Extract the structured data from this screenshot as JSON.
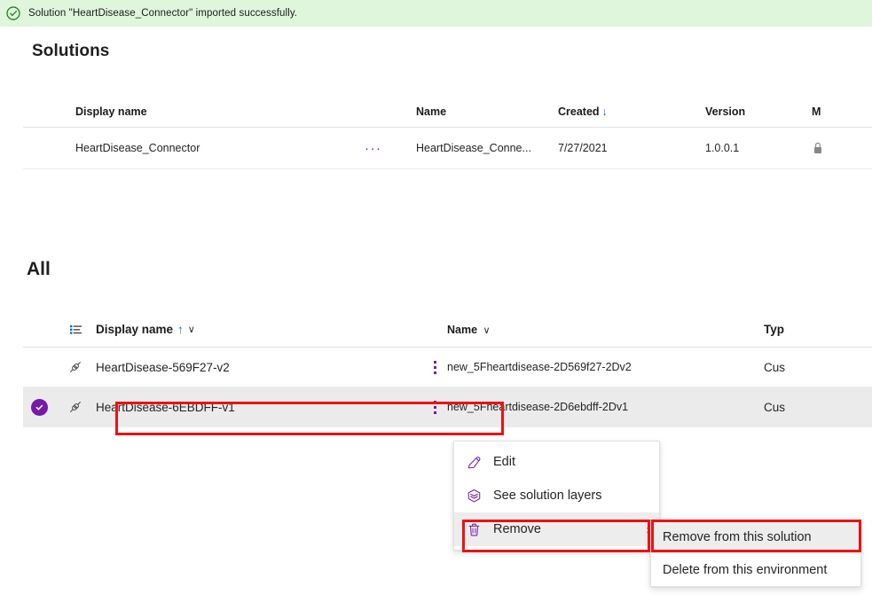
{
  "banner": {
    "icon": "check-circle-icon",
    "message": "Solution \"HeartDisease_Connector\" imported successfully."
  },
  "solutions_section": {
    "title": "Solutions",
    "columns": [
      {
        "label": "Display name"
      },
      {
        "label": "Name"
      },
      {
        "label": "Created",
        "sort": "↓"
      },
      {
        "label": "Version"
      },
      {
        "label": "M"
      }
    ],
    "rows": [
      {
        "display_name": "HeartDisease_Connector",
        "overflow_menu": "···",
        "name": "HeartDisease_Conne...",
        "created": "7/27/2021",
        "version": "1.0.0.1",
        "managed_icon": "managed-lock-icon"
      }
    ]
  },
  "all_section": {
    "title": "All",
    "columns": [
      {
        "label": "",
        "icon": "list-view-icon"
      },
      {
        "label": "Display name",
        "sort": "↑",
        "chevron": "∨"
      },
      {
        "label": "Name",
        "chevron": "∨"
      },
      {
        "label": "Typ"
      }
    ],
    "rows": [
      {
        "selected": false,
        "icon": "connector-icon",
        "display_name": "HeartDisease-569F27-v2",
        "kebab": "kebab-menu-icon",
        "name": "new_5Fheartdisease-2D569f27-2Dv2",
        "type": "Cus"
      },
      {
        "selected": true,
        "check_icon": "selected-check-icon",
        "icon": "connector-icon",
        "display_name": "HeartDisease-6EBDFF-v1",
        "kebab": "kebab-menu-icon",
        "name": "new_5Fheartdisease-2D6ebdff-2Dv1",
        "type": "Cus"
      }
    ]
  },
  "context_menu": {
    "items": [
      {
        "label": "Edit",
        "icon": "pencil-icon",
        "has_submenu": false,
        "hovered": false
      },
      {
        "label": "See solution layers",
        "icon": "layers-icon",
        "has_submenu": false,
        "hovered": false
      },
      {
        "label": "Remove",
        "icon": "trash-icon",
        "has_submenu": true,
        "chevron": "›",
        "hovered": true
      }
    ]
  },
  "submenu": {
    "items": [
      {
        "label": "Remove from this solution",
        "hovered": true
      },
      {
        "label": "Delete from this environment",
        "hovered": false
      }
    ]
  },
  "annotations": [
    {
      "name": "highlight-selected-row"
    },
    {
      "name": "highlight-remove-item"
    },
    {
      "name": "highlight-remove-from-solution"
    }
  ],
  "colors": {
    "banner_bg": "#dff6dd",
    "banner_icon": "#107c10",
    "accent_purple": "#7719aa",
    "sort_blue": "#0f6cbd",
    "annotation_red": "#ee1111",
    "row_selected_bg": "#ebebeb"
  }
}
